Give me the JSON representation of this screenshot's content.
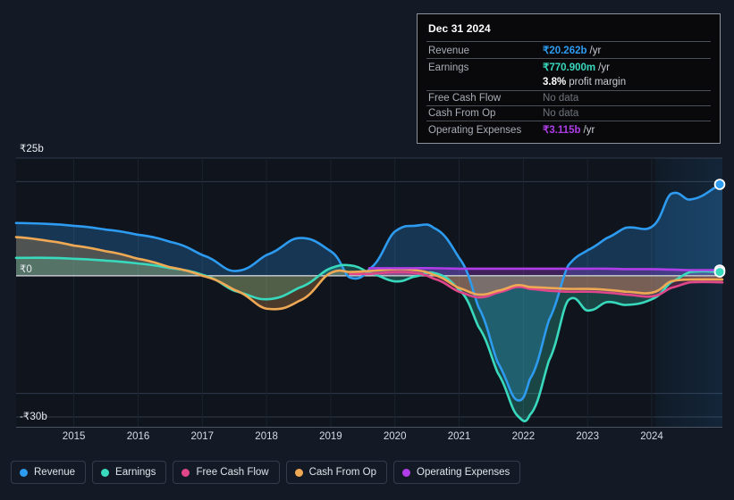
{
  "axes": {
    "y_top_label": "₹25b",
    "y_zero_label": "₹0",
    "y_bottom_label": "-₹30b",
    "x_labels": [
      "2015",
      "2016",
      "2017",
      "2018",
      "2019",
      "2020",
      "2021",
      "2022",
      "2023",
      "2024"
    ]
  },
  "tooltip": {
    "title": "Dec 31 2024",
    "rows": [
      {
        "key": "Revenue",
        "value": "₹20.262b",
        "unit": "/yr",
        "color": "#2d9bf0",
        "nodata": false
      },
      {
        "key": "Earnings",
        "value": "₹770.900m",
        "unit": "/yr",
        "color": "#39d9be",
        "nodata": false
      },
      {
        "key": "",
        "value": "3.8%",
        "unit": "profit margin",
        "color": "#ffffff",
        "nodata": false,
        "margin": true
      },
      {
        "key": "Free Cash Flow",
        "value": "No data",
        "unit": "",
        "color": "#6f747d",
        "nodata": true
      },
      {
        "key": "Cash From Op",
        "value": "No data",
        "unit": "",
        "color": "#6f747d",
        "nodata": true
      },
      {
        "key": "Operating Expenses",
        "value": "₹3.115b",
        "unit": "/yr",
        "color": "#b03ee8",
        "nodata": false
      }
    ]
  },
  "legend": [
    {
      "label": "Revenue",
      "color": "#2d9bf0"
    },
    {
      "label": "Earnings",
      "color": "#39d9be"
    },
    {
      "label": "Free Cash Flow",
      "color": "#e0478a"
    },
    {
      "label": "Cash From Op",
      "color": "#efa954"
    },
    {
      "label": "Operating Expenses",
      "color": "#b03ee8"
    }
  ],
  "chart_data": {
    "type": "area",
    "title": "",
    "xlabel": "",
    "ylabel": "",
    "currency": "INR",
    "units": "billions",
    "ylim": [
      -30,
      25
    ],
    "xlim": [
      2014.1,
      2025.1
    ],
    "grid": true,
    "zero_line": 0,
    "legend_position": "bottom",
    "forecast_start": 2024.05,
    "x": [
      2014.1,
      2014.6,
      2015.0,
      2015.5,
      2016.0,
      2016.5,
      2017.0,
      2017.5,
      2018.0,
      2018.5,
      2019.0,
      2019.3,
      2019.6,
      2020.0,
      2020.3,
      2020.6,
      2021.0,
      2021.3,
      2021.6,
      2021.9,
      2022.1,
      2022.4,
      2022.7,
      2023.0,
      2023.3,
      2023.6,
      2024.0,
      2024.3,
      2024.6,
      2025.1
    ],
    "series": [
      {
        "name": "Revenue",
        "color": "#2d9bf0",
        "values": [
          11.2,
          11.0,
          10.6,
          9.8,
          8.7,
          7.2,
          4.4,
          1.0,
          4.4,
          8.0,
          5.2,
          -0.4,
          1.4,
          9.4,
          10.6,
          10.2,
          3.8,
          -6.6,
          -18.4,
          -26.4,
          -22.0,
          -9.4,
          2.2,
          5.4,
          8.0,
          10.2,
          10.4,
          17.4,
          16.2,
          19.4
        ]
      },
      {
        "name": "Earnings",
        "color": "#39d9be",
        "values": [
          3.8,
          3.8,
          3.6,
          3.2,
          2.6,
          1.6,
          0.2,
          -3.2,
          -5.0,
          -2.6,
          1.6,
          2.2,
          0.6,
          -1.2,
          -0.2,
          0.6,
          -3.0,
          -10.8,
          -20.6,
          -29.6,
          -29.6,
          -18.0,
          -5.2,
          -7.4,
          -5.6,
          -6.2,
          -5.0,
          -1.4,
          0.8,
          0.8
        ]
      },
      {
        "name": "Free Cash Flow",
        "color": "#e0478a",
        "values": [
          null,
          null,
          null,
          null,
          null,
          null,
          null,
          null,
          null,
          null,
          null,
          0.4,
          0.4,
          0.8,
          0.6,
          -0.6,
          -3.4,
          -4.6,
          -3.6,
          -2.4,
          -2.8,
          -3.2,
          -3.4,
          -3.4,
          -3.6,
          -4.0,
          -4.4,
          -2.6,
          -1.4,
          -1.4
        ]
      },
      {
        "name": "Cash From Op",
        "color": "#efa954",
        "values": [
          8.2,
          7.4,
          6.4,
          5.2,
          3.6,
          1.8,
          0.0,
          -3.0,
          -7.0,
          -5.4,
          0.6,
          0.8,
          1.0,
          1.4,
          1.2,
          0.2,
          -2.6,
          -4.0,
          -3.2,
          -2.0,
          -2.4,
          -2.6,
          -2.8,
          -2.8,
          -3.0,
          -3.4,
          -3.6,
          -1.2,
          -0.8,
          -0.8
        ]
      },
      {
        "name": "Operating Expenses",
        "color": "#b03ee8",
        "values": [
          null,
          null,
          null,
          null,
          null,
          null,
          null,
          null,
          null,
          null,
          null,
          null,
          1.6,
          1.6,
          1.6,
          1.6,
          1.5,
          1.5,
          1.5,
          1.5,
          1.5,
          1.5,
          1.5,
          1.5,
          1.5,
          1.4,
          1.4,
          1.3,
          1.2,
          1.2
        ]
      }
    ],
    "endpoints": [
      {
        "name": "Revenue",
        "value": 19.4,
        "color": "#2d9bf0"
      },
      {
        "name": "Operating Expenses",
        "value": 1.2,
        "color": "#b03ee8"
      },
      {
        "name": "Earnings",
        "value": 0.8,
        "color": "#39d9be"
      }
    ]
  }
}
